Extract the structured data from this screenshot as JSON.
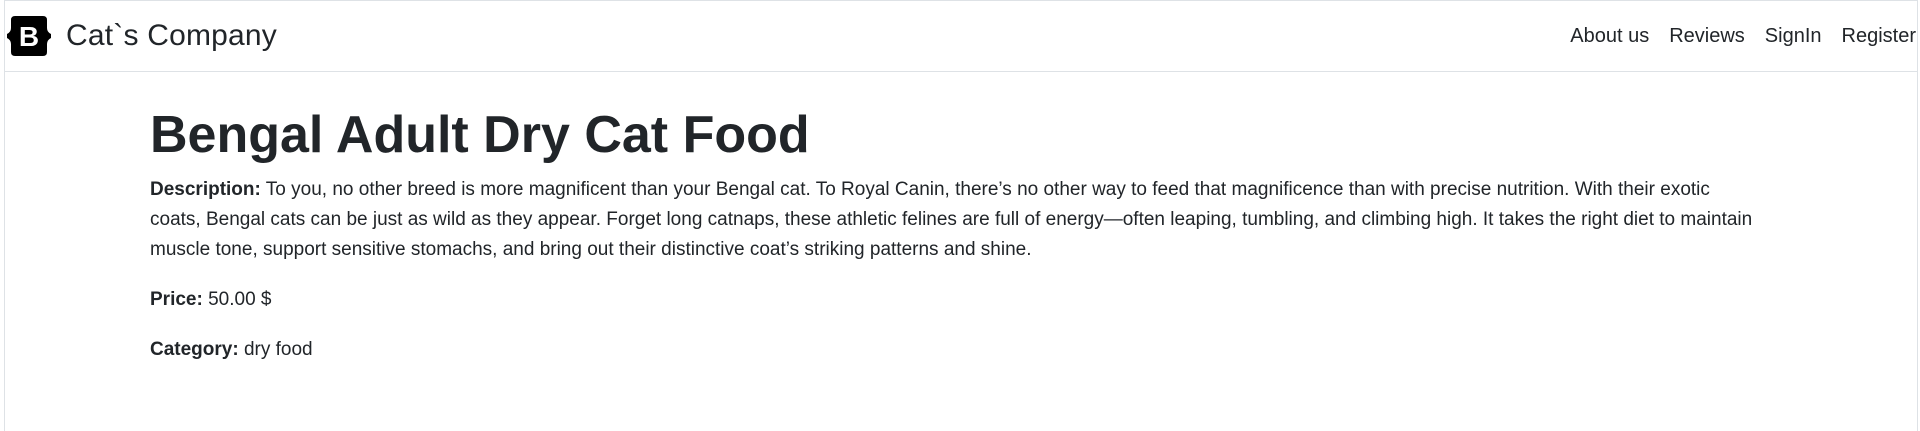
{
  "navbar": {
    "brand_name": "Cat`s Company",
    "logo_letter": "B",
    "links": [
      "About us",
      "Reviews",
      "SignIn",
      "Register"
    ]
  },
  "product": {
    "title": "Bengal Adult Dry Cat Food",
    "description_label": "Description:",
    "description": "To you, no other breed is more magnificent than your Bengal cat. To Royal Canin, there’s no other way to feed that magnificence than with precise nutrition. With their exotic coats, Bengal cats can be just as wild as they appear. Forget long catnaps, these athletic felines are full of energy—often leaping, tumbling, and climbing high. It takes the right diet to maintain muscle tone, support sensitive stomachs, and bring out their distinctive coat’s striking patterns and shine.",
    "price_label": "Price:",
    "price": "50.00 $",
    "category_label": "Category:",
    "category": "dry food"
  },
  "colors": {
    "text": "#212529",
    "border": "#dee2e6",
    "logo_bg": "#000000",
    "logo_fg": "#ffffff"
  },
  "icons": {
    "brand_logo": "bootstrap-logo-icon"
  }
}
